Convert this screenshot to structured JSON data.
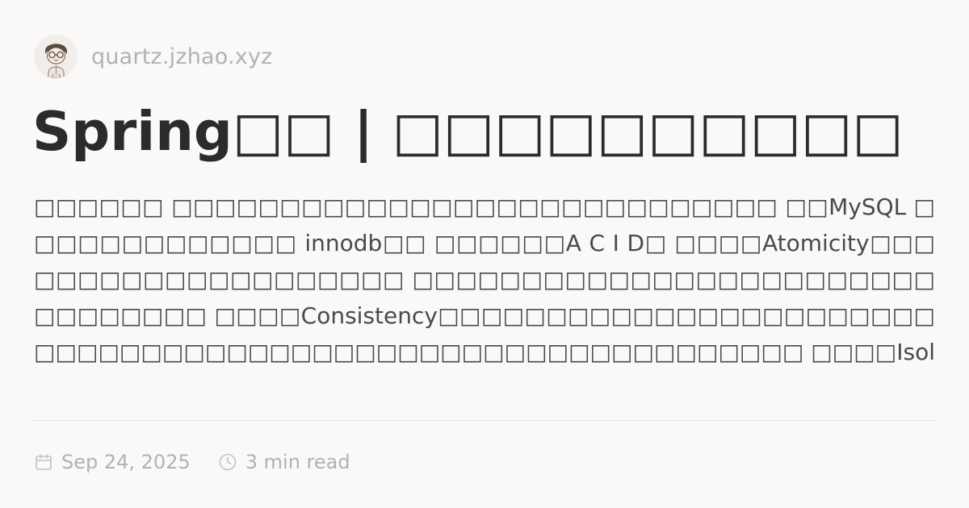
{
  "site": {
    "domain": "quartz.jzhao.xyz",
    "avatar_icon": "cartoon-character-avatar"
  },
  "article": {
    "title": "Spring□□ | □□□□□□□□□□",
    "description": "□□□□□□ □□□□□□□□□□□□□□□□□□□□□□□□□□□□ □□MySQL □□□□□□□□□□□□□ innodb□□ □□□□□□A C I D□ □□□□Atomicity□□□□□□□□□□□□□□□□□□□□ □□□□□□□□□□□□□□□□□□□□□□□□□□□□□□□□ □□□□Consistency□□□□□□□□□□□□□□□□□□□□□□□□□□□□□□□□□□□□□□□□□□□□□□□□□□□□□□□□□□□ □□□□Isolation□□□□□□□□□□□□□□□□□□□□□□□□□□□□□□□□□□□□□□□□□□..."
  },
  "meta": {
    "date": "Sep 24, 2025",
    "date_icon": "calendar-icon",
    "reading_time": "3 min read",
    "reading_time_icon": "clock-icon"
  },
  "colors": {
    "background": "#faf8f8",
    "title": "#2b2b2b",
    "body_text": "#4a4a4a",
    "muted": "#b2b2b2",
    "divider": "#e7e4e4"
  }
}
